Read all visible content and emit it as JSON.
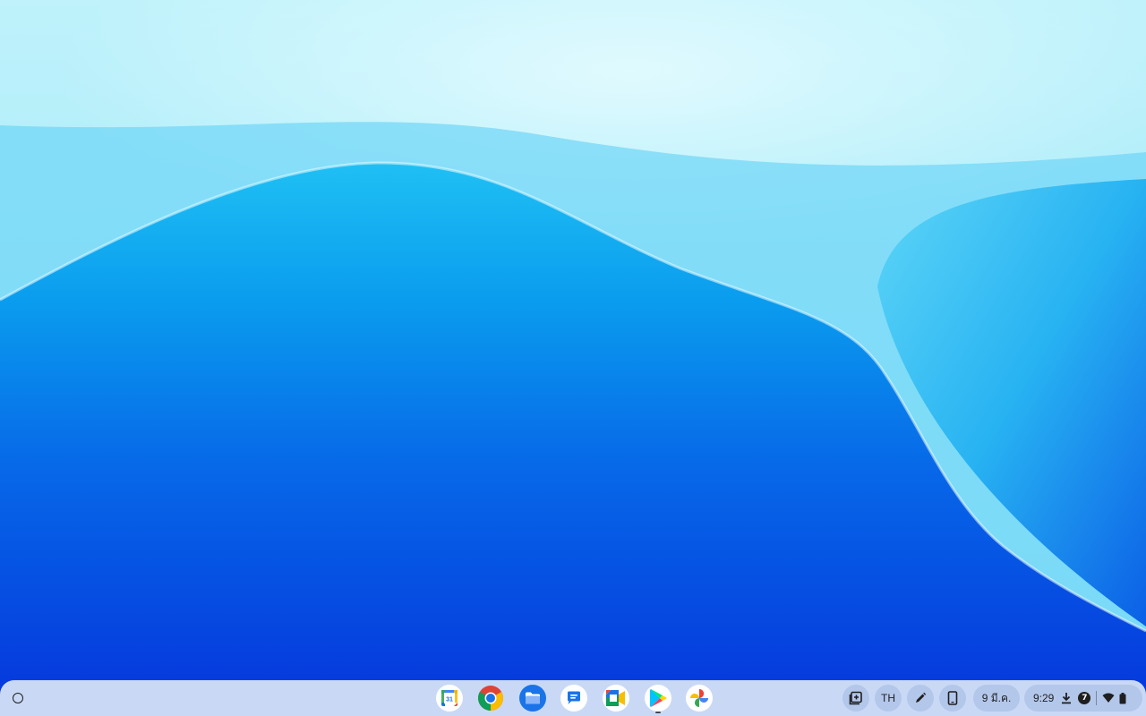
{
  "desktop": {
    "wallpaper": "blue-wave-wallpaper",
    "colors": {
      "top": "#b8f0fb",
      "middle": "#0a86ea",
      "bottom": "#0533db"
    }
  },
  "shelf": {
    "background": "#c9d9f5",
    "launcher_icon": "launcher-circle-icon",
    "apps": [
      {
        "name": "calendar",
        "icon": "calendar-icon",
        "label": "31",
        "running": false
      },
      {
        "name": "chrome",
        "icon": "chrome-icon",
        "running": false
      },
      {
        "name": "files",
        "icon": "folder-icon",
        "running": false
      },
      {
        "name": "messages",
        "icon": "messages-icon",
        "running": false
      },
      {
        "name": "meet",
        "icon": "meet-icon",
        "running": false
      },
      {
        "name": "play-store",
        "icon": "play-store-icon",
        "running": true
      },
      {
        "name": "photos",
        "icon": "photos-icon",
        "running": false
      }
    ]
  },
  "tray": {
    "clipboard_icon": "clipboard-add-icon",
    "input_method": "TH",
    "stylus_icon": "pen-icon",
    "phone_hub_icon": "phone-icon",
    "date": "9 มี.ค.",
    "time": "9:29",
    "download_icon": "download-icon",
    "notification_count": "7",
    "wifi_icon": "wifi-icon",
    "battery_icon": "battery-icon"
  }
}
